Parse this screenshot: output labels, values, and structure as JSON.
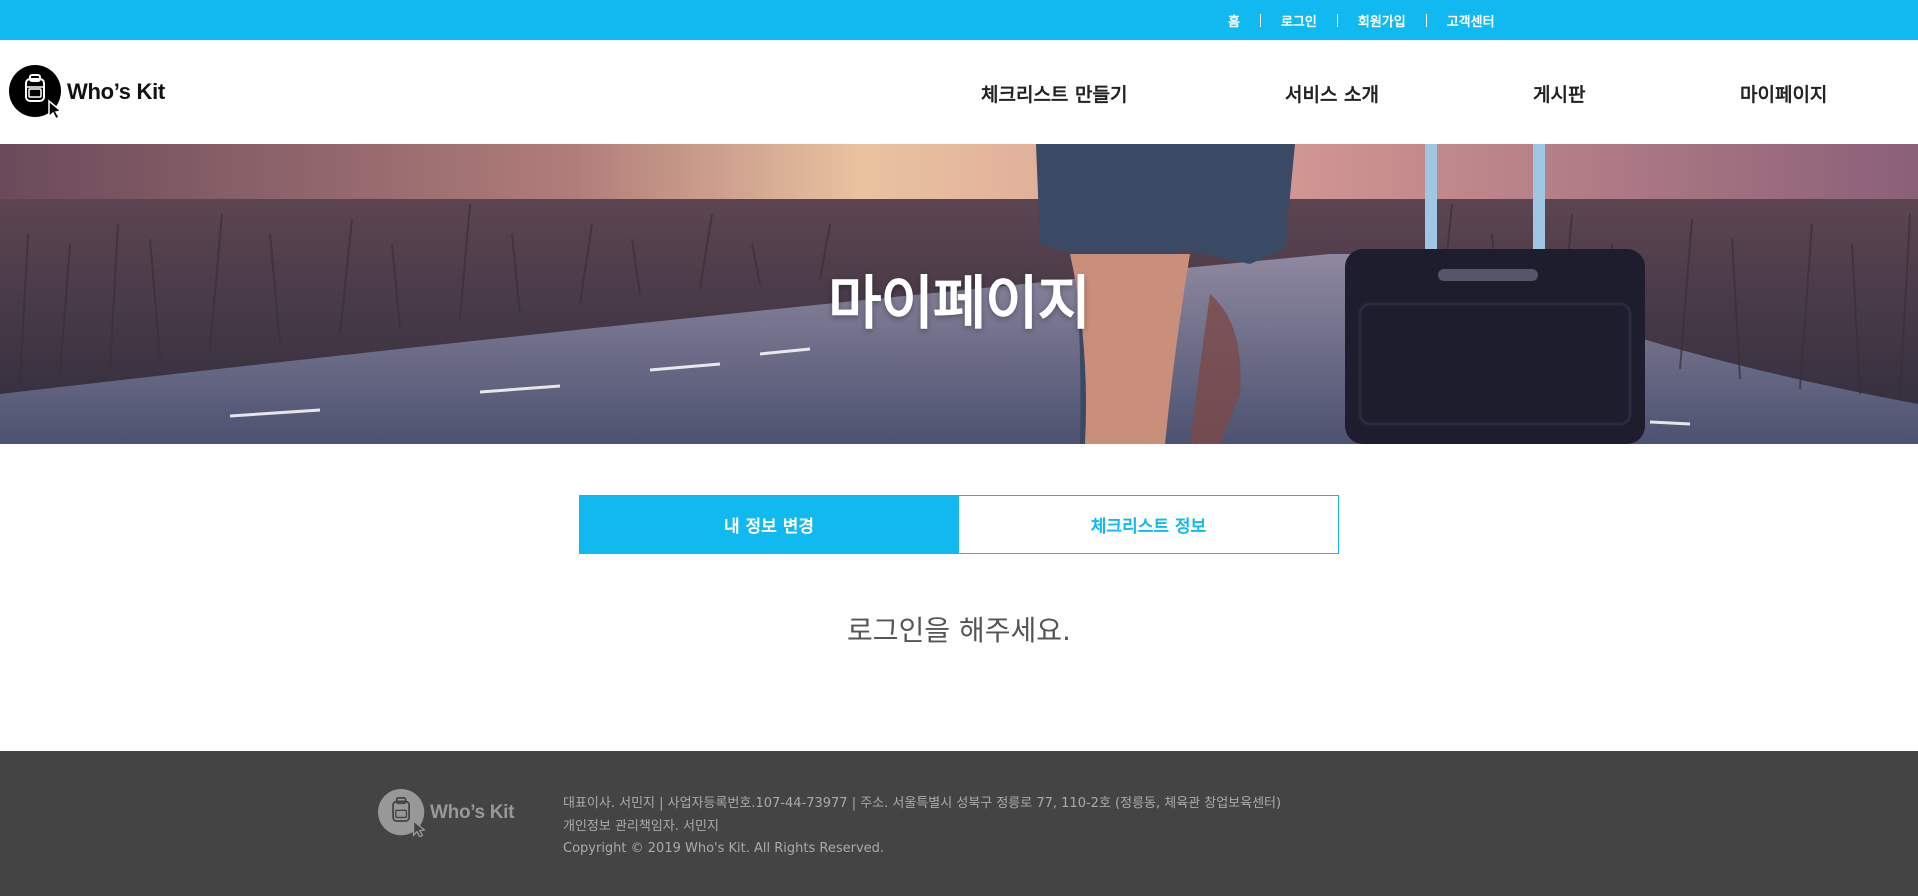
{
  "topbar": {
    "links": [
      "홈",
      "로그인",
      "회원가입",
      "고객센터"
    ]
  },
  "header": {
    "logo_text": "Who’s Kit",
    "nav": [
      "체크리스트 만들기",
      "서비스 소개",
      "게시판",
      "마이페이지"
    ]
  },
  "hero": {
    "title": "마이페이지"
  },
  "tabs": {
    "active": "내 정보 변경",
    "inactive": "체크리스트 정보"
  },
  "main": {
    "message": "로그인을 해주세요."
  },
  "footer": {
    "logo_text": "Who’s Kit",
    "line1": "대표이사. 서민지 | 사업자등록번호.107-44-73977 | 주소. 서울특별시 성북구 정릉로 77, 110-2호 (정릉동, 체육관 창업보육센터)",
    "line2": "개인정보 관리책임자. 서민지",
    "line3": "Copyright © 2019 Who's Kit. All Rights Reserved."
  },
  "colors": {
    "accent": "#10b9ef",
    "footer_bg": "#444444"
  }
}
